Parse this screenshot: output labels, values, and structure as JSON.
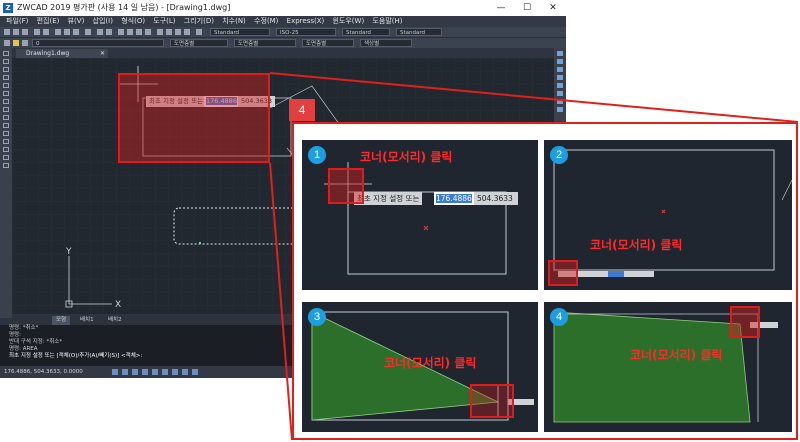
{
  "window": {
    "title": "ZWCAD 2019 평가판 (사용 14 일 남음) - [Drawing1.dwg]",
    "logo_text": "Z",
    "minimize": "—",
    "maximize": "☐",
    "close": "✕"
  },
  "menu": [
    "파일(F)",
    "편집(E)",
    "뷰(V)",
    "삽입(I)",
    "형식(O)",
    "도구(L)",
    "그리기(D)",
    "치수(N)",
    "수정(M)",
    "Express(X)",
    "윈도우(W)",
    "도움말(H)"
  ],
  "toolbar": {
    "text_style": "Standard",
    "dim_style": "ISO-25",
    "table_style": "Standard",
    "multileader_style": "Standard",
    "layer": "0",
    "color": "도면층별",
    "linetype": "도면층별",
    "lineweight": "도면층별",
    "plot_style": "색상별"
  },
  "doc_tab": {
    "name": "Drawing1.dwg",
    "close": "✕"
  },
  "canvas": {
    "prompt_label": "최초 지정 설정 또는",
    "prompt_value1": "176.4886",
    "prompt_value2": "504.3633",
    "ucs_x": "X",
    "ucs_y": "Y"
  },
  "layout_tabs": [
    "모형",
    "배치1",
    "배치2"
  ],
  "command_lines": [
    "명령: *취소*",
    "명령:",
    "반대 구석 지정: *취소*",
    "명령: AREA",
    "최초 지정 설정 또는 [객체(O)/추가(A)/빼기(S)] <객체>:"
  ],
  "status_coords": "176.4886, 504.3633, 0.0000",
  "callout": {
    "number": "4",
    "steps": [
      {
        "num": "1",
        "caption": "코너(모서리) 클릭",
        "prompt_label": "최초 지정 설정 또는",
        "prompt_value1": "176.4886",
        "prompt_value2": "504.3633"
      },
      {
        "num": "2",
        "caption": "코너(모서리) 클릭"
      },
      {
        "num": "3",
        "caption": "코너(모서리) 클릭"
      },
      {
        "num": "4",
        "caption": "코너(모서리) 클릭"
      }
    ]
  },
  "colors": {
    "highlight": "#e01b1b",
    "badge": "#1d9ee0",
    "cad_background": "#212830",
    "area_fill": "#2f7d2a"
  }
}
